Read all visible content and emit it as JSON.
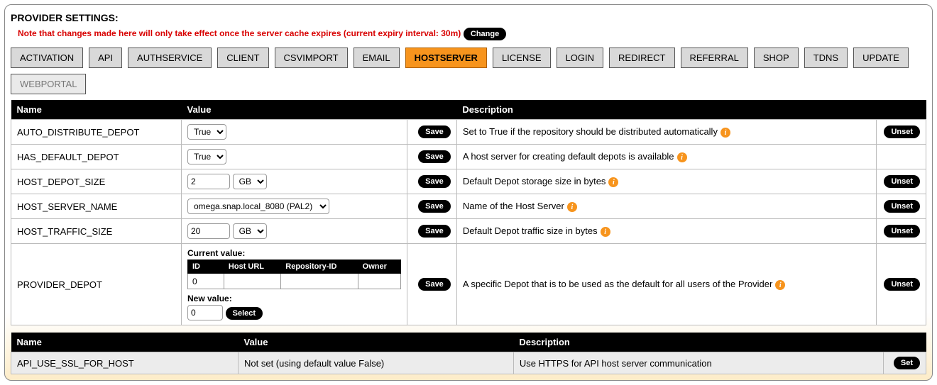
{
  "title": "PROVIDER SETTINGS:",
  "note": "Note that changes made here will only take effect once the server cache expires (current expiry interval: 30m)",
  "change_label": "Change",
  "tabs": [
    {
      "label": "ACTIVATION"
    },
    {
      "label": "API"
    },
    {
      "label": "AUTHSERVICE"
    },
    {
      "label": "CLIENT"
    },
    {
      "label": "CSVIMPORT"
    },
    {
      "label": "EMAIL"
    },
    {
      "label": "HOSTSERVER",
      "active": true
    },
    {
      "label": "LICENSE"
    },
    {
      "label": "LOGIN"
    },
    {
      "label": "REDIRECT"
    },
    {
      "label": "REFERRAL"
    },
    {
      "label": "SHOP"
    },
    {
      "label": "TDNS"
    },
    {
      "label": "UPDATE"
    },
    {
      "label": "WEBPORTAL",
      "light": true
    }
  ],
  "table1": {
    "headers": {
      "name": "Name",
      "value": "Value",
      "description": "Description"
    },
    "save_label": "Save",
    "unset_label": "Unset",
    "select_label": "Select",
    "rows": [
      {
        "name": "AUTO_DISTRIBUTE_DEPOT",
        "value_select": "True",
        "desc": "Set to True if the repository should be distributed automatically",
        "unset": true
      },
      {
        "name": "HAS_DEFAULT_DEPOT",
        "value_select": "True",
        "desc": "A host server for creating default depots is available",
        "unset": false
      },
      {
        "name": "HOST_DEPOT_SIZE",
        "value_num": "2",
        "value_unit": "GB",
        "desc": "Default Depot storage size in bytes",
        "unset": true
      },
      {
        "name": "HOST_SERVER_NAME",
        "value_select": "omega.snap.local_8080 (PAL2)",
        "desc": "Name of the Host Server",
        "unset": true
      },
      {
        "name": "HOST_TRAFFIC_SIZE",
        "value_num": "20",
        "value_unit": "GB",
        "desc": "Default Depot traffic size in bytes",
        "unset": true
      }
    ],
    "provider_depot": {
      "name": "PROVIDER_DEPOT",
      "current_label": "Current value:",
      "cols": {
        "id": "ID",
        "hosturl": "Host URL",
        "repoid": "Repository-ID",
        "owner": "Owner"
      },
      "cur_id": "0",
      "new_label": "New value:",
      "new_id": "0",
      "desc": "A specific Depot that is to be used as the default for all users of the Provider",
      "unset": true
    }
  },
  "table2": {
    "headers": {
      "name": "Name",
      "value": "Value",
      "description": "Description"
    },
    "set_label": "Set",
    "rows": [
      {
        "name": "API_USE_SSL_FOR_HOST",
        "value": "Not set (using default value False)",
        "desc": "Use HTTPS for API host server communication"
      }
    ]
  }
}
